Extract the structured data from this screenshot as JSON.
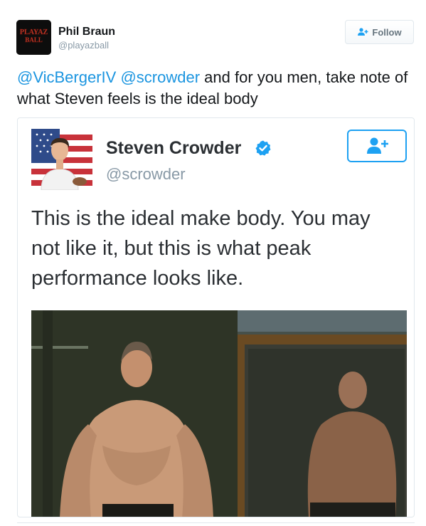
{
  "tweet": {
    "author_name": "Phil Braun",
    "author_handle": "@playazball",
    "avatar_text_top": "PLAYAZ",
    "avatar_text_bottom": "BALL",
    "follow_label": "Follow",
    "text": {
      "mention_1": "@VicBergerIV",
      "mention_2": "@scrowder",
      "body": " and for you men, take note of what Steven feels is the ideal body"
    }
  },
  "quoted": {
    "author_name": "Steven Crowder",
    "author_handle": "@scrowder",
    "verified": true,
    "text": "This is the ideal make body. You may not like it, but this is what peak performance looks like.",
    "photo_icon": "shirtless-man-photo"
  },
  "colors": {
    "link": "#1b95e0",
    "verified": "#1da1f2",
    "muted": "#8899a6",
    "border": "#e1e8ed"
  }
}
